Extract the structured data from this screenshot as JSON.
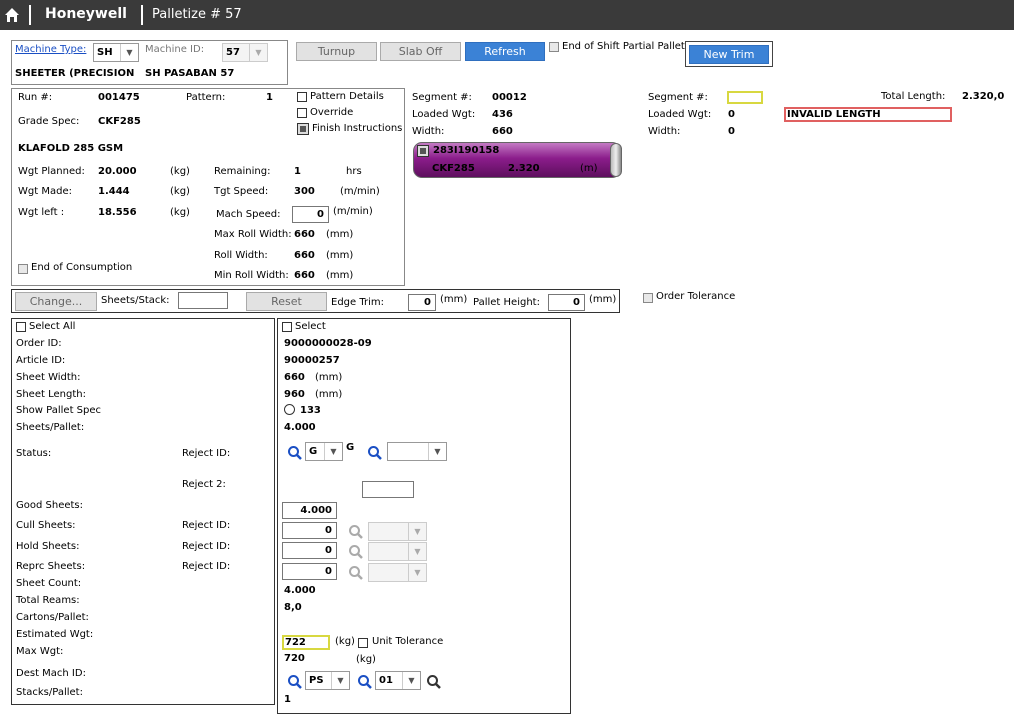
{
  "header": {
    "brand": "Honeywell",
    "title": "Palletize # 57"
  },
  "machine": {
    "type_label": "Machine Type:",
    "type_value": "SH",
    "id_label": "Machine ID:",
    "id_value": "57",
    "description": "SHEETER (PRECISION",
    "name": "SH PASABAN 57"
  },
  "toolbar": {
    "turnup": "Turnup",
    "slab_off": "Slab Off",
    "refresh": "Refresh",
    "end_shift": "End of Shift Partial Pallet",
    "new_trim": "New Trim"
  },
  "run": {
    "run_label": "Run #:",
    "run_value": "001475",
    "pattern_label": "Pattern:",
    "pattern_value": "1",
    "pattern_details": "Pattern Details",
    "override": "Override",
    "finish_instructions": "Finish Instructions",
    "grade_label": "Grade Spec:",
    "grade_value": "CKF285",
    "grade_desc": "KLAFOLD 285 GSM",
    "wgt_planned_label": "Wgt Planned:",
    "wgt_planned": "20.000",
    "wgt_made_label": "Wgt Made:",
    "wgt_made": "1.444",
    "wgt_left_label": "Wgt left :",
    "wgt_left": "18.556",
    "kg": "(kg)",
    "remaining_label": "Remaining:",
    "remaining": "1",
    "hrs": "hrs",
    "tgt_speed_label": "Tgt Speed:",
    "tgt_speed": "300",
    "mmin": "(m/min)",
    "mach_speed_label": "Mach Speed:",
    "mach_speed": "0",
    "max_roll_label": "Max Roll Width:",
    "max_roll": "660",
    "roll_width_label": "Roll Width:",
    "roll_width": "660",
    "min_roll_label": "Min Roll Width:",
    "min_roll": "660",
    "mm": "(mm)",
    "end_consumption": "End of Consumption"
  },
  "segment": {
    "seg_label": "Segment #:",
    "seg_value": "00012",
    "loaded_label": "Loaded Wgt:",
    "loaded_value": "436",
    "width_label": "Width:",
    "width_value": "660",
    "roll_id": "283I190158",
    "roll_grade": "CKF285",
    "roll_length": "2.320",
    "roll_unit": "(m)"
  },
  "segment2": {
    "seg_label": "Segment #:",
    "loaded_label": "Loaded Wgt:",
    "loaded_value": "0",
    "width_label": "Width:",
    "width_value": "0",
    "total_label": "Total Length:",
    "total_value": "2.320,0",
    "error": "INVALID LENGTH"
  },
  "trimbar": {
    "change": "Change...",
    "sheets_stack": "Sheets/Stack:",
    "reset": "Reset",
    "edge_trim": "Edge Trim:",
    "edge_trim_value": "0",
    "mm": "(mm)",
    "pallet_height": "Pallet Height:",
    "pallet_height_value": "0",
    "order_tolerance": "Order Tolerance"
  },
  "order_labels": {
    "select_all": "Select All",
    "order_id": "Order ID:",
    "article_id": "Article ID:",
    "sheet_width": "Sheet Width:",
    "sheet_length": "Sheet Length:",
    "show_pallet": "Show Pallet Spec",
    "sheets_pallet": "Sheets/Pallet:",
    "status": "Status:",
    "reject_id": "Reject ID:",
    "reject2": "Reject 2:",
    "good": "Good Sheets:",
    "cull": "Cull Sheets:",
    "hold": "Hold Sheets:",
    "reprc": "Reprc Sheets:",
    "sheet_count": "Sheet Count:",
    "total_reams": "Total Reams:",
    "cartons": "Cartons/Pallet:",
    "est_wgt": "Estimated Wgt:",
    "max_wgt": "Max Wgt:",
    "dest": "Dest Mach ID:",
    "stacks": "Stacks/Pallet:"
  },
  "order": {
    "select": "Select",
    "order_id": "9000000028-09",
    "article_id": "90000257",
    "sheet_width": "660",
    "sheet_length": "960",
    "mm": "(mm)",
    "pallet_spec": "133",
    "sheets_pallet": "4.000",
    "status": "G",
    "status_code": "G",
    "good": "4.000",
    "cull": "0",
    "hold": "0",
    "reprc": "0",
    "sheet_count": "4.000",
    "total_reams": "8,0",
    "est_wgt": "722",
    "kg": "(kg)",
    "unit_tolerance": "Unit Tolerance",
    "max_wgt": "720",
    "kg2": "(kg)",
    "dest": "PS",
    "dest2": "01",
    "stacks": "1"
  },
  "colors": {
    "topbar": "#3a3a3a",
    "accent": "#3b82d6",
    "roll": "#8b1d8b",
    "error_border": "#e06060",
    "warn_border": "#d8d840"
  }
}
